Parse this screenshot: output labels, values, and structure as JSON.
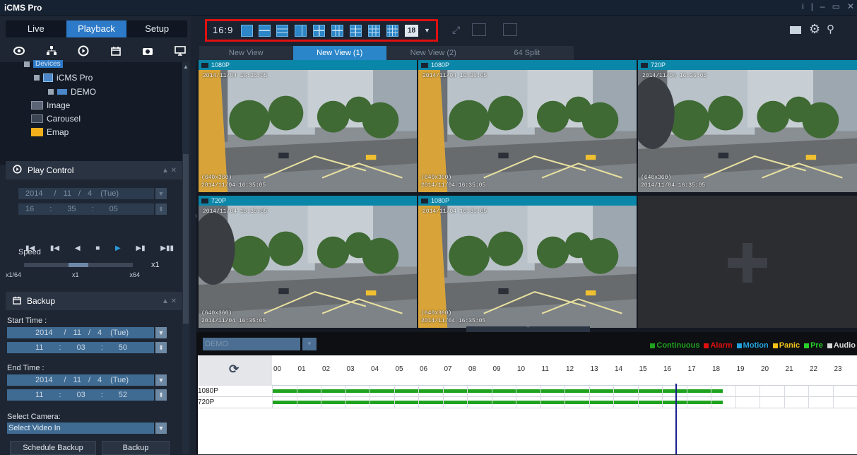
{
  "app": {
    "title": "iCMS Pro"
  },
  "window_controls": [
    "i",
    "|",
    "–",
    "▭",
    "✕"
  ],
  "sidebar": {
    "tabs": [
      {
        "label": "Live"
      },
      {
        "label": "Playback"
      },
      {
        "label": "Setup"
      }
    ],
    "active_tab": "Playback",
    "mode_icons": [
      "eye-icon",
      "network-icon",
      "play-circle-icon",
      "calendar-icon",
      "camera-icon",
      "monitor-icon"
    ],
    "tree": {
      "root": "Devices",
      "server": "iCMS Pro",
      "device": "DEMO",
      "items": [
        "Image",
        "Carousel",
        "Emap"
      ]
    },
    "play_control": {
      "title": "Play Control",
      "date": {
        "year": "2014",
        "month": "11",
        "day": "4",
        "weekday": "(Tue)"
      },
      "time": {
        "h": "16",
        "m": "35",
        "s": "05"
      },
      "buttons": [
        "frame-back-icon",
        "skip-start-icon",
        "play-reverse-icon",
        "stop-icon",
        "play-icon",
        "skip-end-icon",
        "frame-forward-icon"
      ],
      "speed_label": "Speed",
      "speed_value": "x1",
      "speed_level": 0.5,
      "scale": {
        "min": "x1/64",
        "mid": "x1",
        "max": "x64"
      }
    },
    "backup": {
      "title": "Backup",
      "start_label": "Start Time :",
      "start_date": {
        "year": "2014",
        "month": "11",
        "day": "4",
        "weekday": "(Tue)"
      },
      "start_time": {
        "h": "11",
        "m": "03",
        "s": "50"
      },
      "end_label": "End Time :",
      "end_date": {
        "year": "2014",
        "month": "11",
        "day": "4",
        "weekday": "(Tue)"
      },
      "end_time": {
        "h": "11",
        "m": "03",
        "s": "52"
      },
      "camera_label": "Select Camera:",
      "camera_placeholder": "Select Video In",
      "schedule_button": "Schedule Backup",
      "backup_button": "Backup"
    }
  },
  "toolbar": {
    "aspect": "16:9",
    "layout_count": "18",
    "layouts": [
      "layout-1-icon",
      "layout-2h-icon",
      "layout-3h-icon",
      "layout-1p2-icon",
      "layout-4-icon",
      "layout-6-icon",
      "layout-8-icon",
      "layout-9-icon"
    ],
    "right_icons": [
      "keyboard-icon",
      "gear-icon",
      "search-icon"
    ]
  },
  "view_tabs": [
    {
      "label": "New View"
    },
    {
      "label": "New View (1)"
    },
    {
      "label": "New View (2)"
    },
    {
      "label": "64 Split"
    }
  ],
  "active_view": "New View (1)",
  "cameras": [
    {
      "resolution": "1080P",
      "osd_top": "2014/11/04 16:35:05",
      "size": "(640x360)",
      "timestamp": "2014/11/04 16:35:05"
    },
    {
      "resolution": "1080P",
      "osd_top": "2014/11/04 16:35:05",
      "size": "(640x360)",
      "timestamp": "2014/11/04 16:35:05"
    },
    {
      "resolution": "720P",
      "osd_top": "2014/11/04 16:35:05",
      "size": "(640x360)",
      "timestamp": "2014/11/04 16:35:05"
    },
    {
      "resolution": "720P",
      "osd_top": "2014/11/04 16:35:05",
      "size": "(640x360)",
      "timestamp": "2014/11/04 16:35:05"
    },
    {
      "resolution": "1080P",
      "osd_top": "2014/11/04 16:35:05",
      "size": "(640x360)",
      "timestamp": "2014/11/04 16:35:05"
    }
  ],
  "empty_cell_icon": "plus-icon",
  "timeline": {
    "device_select": "DEMO",
    "legend": [
      {
        "label": "Continuous",
        "color": "#1fa31f"
      },
      {
        "label": "Alarm",
        "color": "#e01010"
      },
      {
        "label": "Motion",
        "color": "#22a3e0"
      },
      {
        "label": "Panic",
        "color": "#f2c21a"
      },
      {
        "label": "Pre",
        "color": "#29d129"
      },
      {
        "label": "Audio",
        "color": "#d9d9d9"
      }
    ],
    "hours": [
      "00",
      "01",
      "02",
      "03",
      "04",
      "05",
      "06",
      "07",
      "08",
      "09",
      "10",
      "11",
      "12",
      "13",
      "14",
      "15",
      "16",
      "17",
      "18",
      "19",
      "20",
      "21",
      "22",
      "23"
    ],
    "tracks": [
      {
        "label": "1080P",
        "start_hour": 0,
        "end_hour": 18.5
      },
      {
        "label": "720P",
        "start_hour": 0,
        "end_hour": 18.5
      }
    ],
    "cursor_hour": 16.55,
    "recording_color": "#1fa31f"
  }
}
